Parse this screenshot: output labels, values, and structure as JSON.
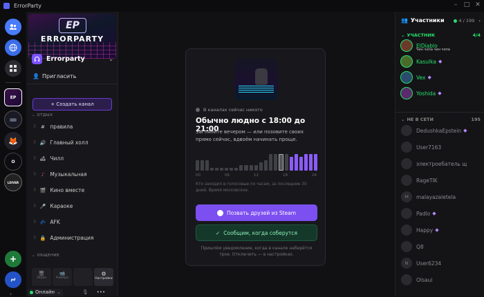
{
  "app": {
    "title": "ErrorParty"
  },
  "rail": {
    "icons": [
      "friends-icon",
      "globe-icon",
      "grid-icon"
    ],
    "servers": [
      "EP",
      "O",
      "LDIVER"
    ],
    "add_icon": "plus-icon",
    "link_icon": "link-icon"
  },
  "channels": {
    "banner_logo": "EP",
    "banner_text": "ERRORPARTY",
    "server_name": "Errorparty",
    "invite_label": "Пригласить",
    "create_channel_label": "+ Создать канал",
    "category_rest": "ОТДЫХ",
    "category_talk": "ОБЩЕНИЕ",
    "items": [
      {
        "icon": "#",
        "label": "правила"
      },
      {
        "icon": "🔊",
        "label": "Главный холл"
      },
      {
        "icon": "🛋",
        "label": "Чилл"
      },
      {
        "icon": "♪",
        "label": "Музыкальная"
      },
      {
        "icon": "🎬",
        "label": "Кино вместе"
      },
      {
        "icon": "🎤",
        "label": "Караоке"
      },
      {
        "icon": "💤",
        "label": "AFK"
      },
      {
        "icon": "🔒",
        "label": "Администрация"
      }
    ],
    "voice_bar": {
      "screen": "Экран",
      "camera": "Камера",
      "settings": "Настройки"
    },
    "status": "Онлайн"
  },
  "card": {
    "status": "В каналах сейчас никого",
    "heading": "Обычно людно с 18:00 до 21:00",
    "description": "Загляните вечером — или позовите своих прямо сейчас, вдвоём начинать проще.",
    "activity": [
      0.45,
      0.45,
      0.45,
      0.12,
      0.12,
      0.12,
      0.12,
      0.12,
      0.12,
      0.25,
      0.25,
      0.25,
      0.25,
      0.35,
      0.45,
      0.72,
      0.72,
      0.72,
      0.72,
      0.58,
      0.72,
      0.58,
      0.72,
      0.72,
      0.72
    ],
    "highlight_from": 19,
    "selected": 17,
    "ticks": [
      "00",
      "06",
      "12",
      "18",
      "24"
    ],
    "hint": "Кто заходил в голосовые по часам, за последние 30 дней. Время московское.",
    "steam_button": "Позвать друзей из Steam",
    "notify_button": "Сообщим, когда соберутся",
    "footer": "Пришлём уведомление, когда в канале наберётся трое. Отключить — в настройках."
  },
  "members": {
    "title": "Участники",
    "online_count": "4",
    "total_count": "199",
    "section_online": "УЧАСТНИК",
    "section_online_count": "4/4",
    "section_offline": "НЕ В СЕТИ",
    "section_offline_count": "195",
    "online": [
      {
        "name": "ElDiablo",
        "sub": "Чин чопа чин чопа",
        "gem": false
      },
      {
        "name": "Kasulka",
        "sub": "",
        "gem": true
      },
      {
        "name": "Vex",
        "sub": "",
        "gem": true
      },
      {
        "name": "Yoshida",
        "sub": "",
        "gem": true
      }
    ],
    "offline": [
      {
        "name": "DedushkaEpstein",
        "initial": "",
        "gem": true
      },
      {
        "name": "User7163",
        "initial": "",
        "gem": false
      },
      {
        "name": "электроебатель щ",
        "initial": "",
        "gem": false
      },
      {
        "name": "RageTIK",
        "initial": "",
        "gem": false
      },
      {
        "name": "malayazaletela",
        "initial": "M",
        "gem": false
      },
      {
        "name": "Padlo",
        "initial": "",
        "gem": true
      },
      {
        "name": "Happy",
        "initial": "",
        "gem": true
      },
      {
        "name": "Q8",
        "initial": "",
        "gem": false
      },
      {
        "name": "User6234",
        "initial": "N",
        "gem": false
      },
      {
        "name": "Olsaui",
        "initial": "",
        "gem": false
      }
    ]
  },
  "colors": {
    "accent": "#7c4ff0",
    "online": "#27e06b",
    "success_bg": "#14382a"
  }
}
